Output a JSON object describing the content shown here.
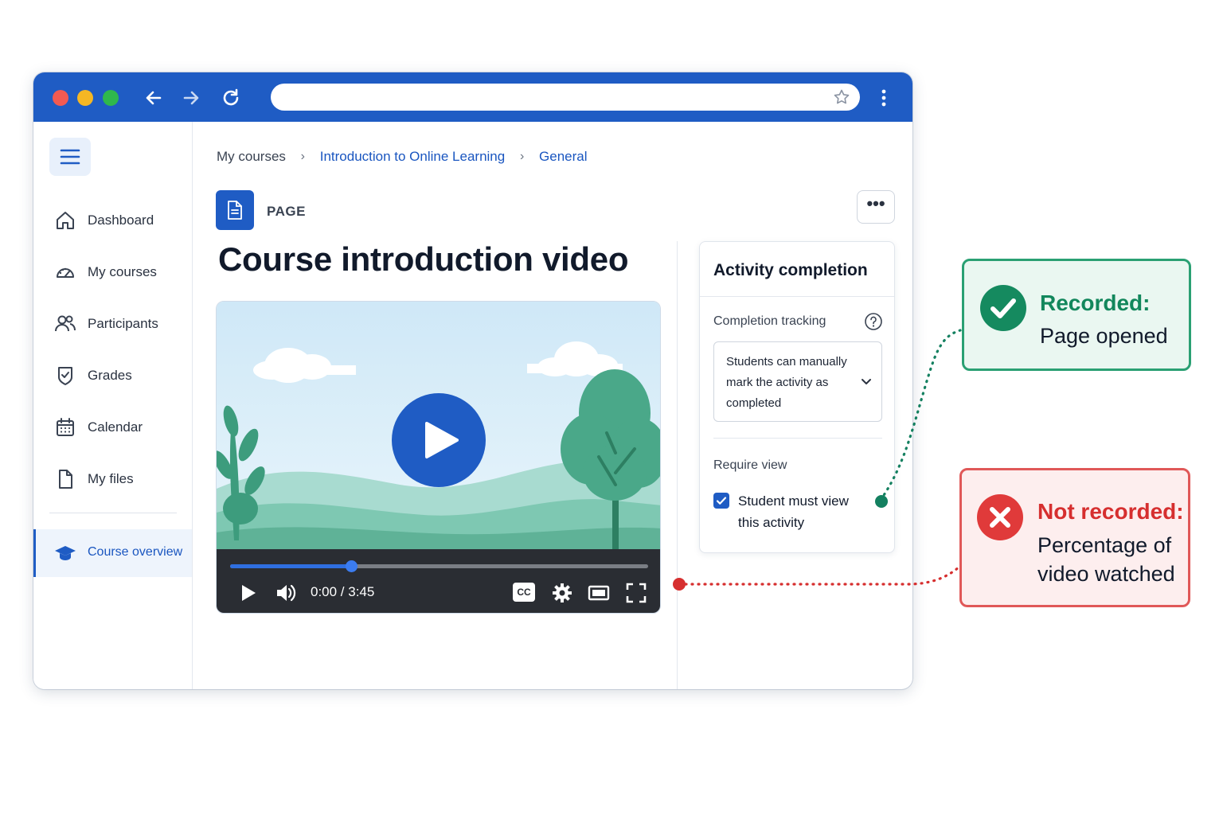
{
  "colors": {
    "chrome": "#1f5cc4",
    "accent": "#1a56c0",
    "recorded": "#12875c",
    "not_recorded": "#d62f2f"
  },
  "browser": {
    "address_value": "",
    "icons": [
      "arrow-left-icon",
      "arrow-right-icon",
      "reload-icon",
      "star-icon",
      "kebab-menu-icon"
    ]
  },
  "sidebar": {
    "items": [
      {
        "label": "Dashboard",
        "icon": "home-icon"
      },
      {
        "label": "My courses",
        "icon": "gauge-icon"
      },
      {
        "label": "Participants",
        "icon": "users-icon"
      },
      {
        "label": "Grades",
        "icon": "shield-check-icon"
      },
      {
        "label": "Calendar",
        "icon": "calendar-icon"
      },
      {
        "label": "My files",
        "icon": "file-icon"
      }
    ],
    "course_overview": {
      "label": "Course overview",
      "icon": "graduation-cap-icon"
    }
  },
  "breadcrumb": {
    "items": [
      "My courses",
      "Introduction to Online Learning",
      "General"
    ]
  },
  "page": {
    "kind": "PAGE",
    "title": "Course introduction video",
    "more_label": "•••"
  },
  "video": {
    "time": "0:00 / 3:45",
    "progress": 0.29,
    "cc_label": "CC"
  },
  "completion": {
    "title": "Activity completion",
    "tracking_label": "Completion tracking",
    "tracking_value": "Students can manually mark the activity as completed",
    "require_view_label": "Require view",
    "checkbox_label": "Student must view this activity",
    "checkbox_checked": true
  },
  "callouts": {
    "recorded": {
      "head": "Recorded:",
      "body": "Page opened"
    },
    "not_recorded": {
      "head": "Not recorded:",
      "body": "Percentage of video watched"
    }
  }
}
